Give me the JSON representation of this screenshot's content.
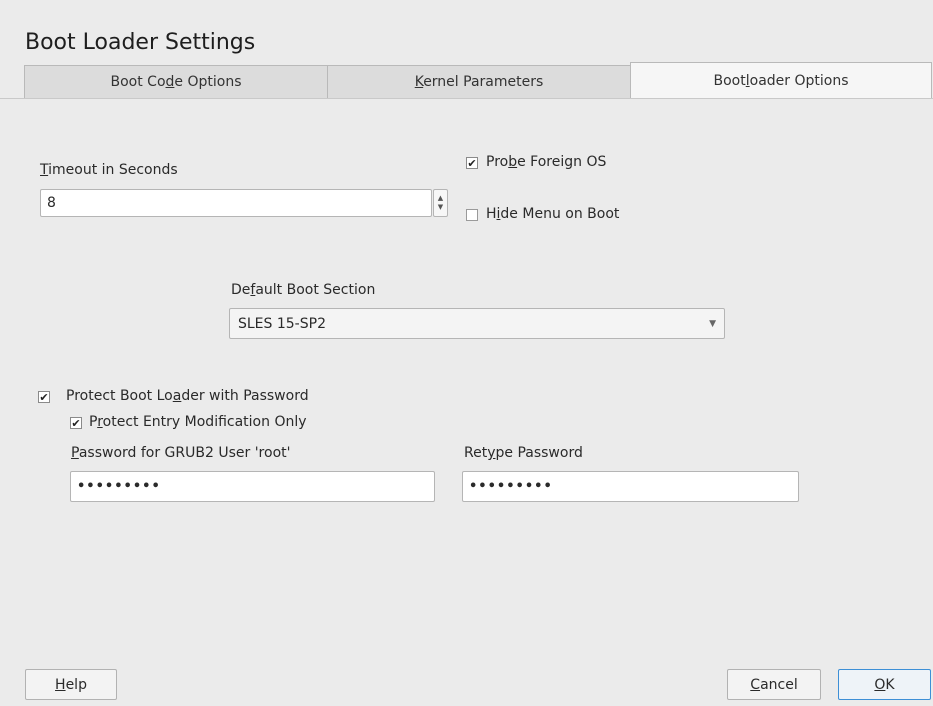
{
  "window": {
    "title": "Boot Loader Settings"
  },
  "tabs": [
    {
      "label_pre": "Boot Co",
      "label_u": "d",
      "label_post": "e Options",
      "active": false
    },
    {
      "label_pre": "",
      "label_u": "K",
      "label_post": "ernel Parameters",
      "active": false
    },
    {
      "label_pre": "Boot",
      "label_u": "l",
      "label_post": "oader Options",
      "active": true
    }
  ],
  "timeout": {
    "label_u": "T",
    "label_rest": "imeout in Seconds",
    "value": "8"
  },
  "probe_foreign_os": {
    "pre": "Pro",
    "u": "b",
    "post": "e Foreign OS",
    "checked": true
  },
  "hide_menu": {
    "pre": "H",
    "u": "i",
    "post": "de Menu on Boot",
    "checked": false
  },
  "default_boot": {
    "pre": "De",
    "u": "f",
    "post": "ault Boot Section",
    "value": "SLES 15-SP2"
  },
  "protect_password": {
    "pre": "Protect Boot Lo",
    "u": "a",
    "post": "der with Password",
    "checked": true
  },
  "protect_entry": {
    "pre": "P",
    "u": "r",
    "post": "otect Entry Modification Only",
    "checked": true
  },
  "password": {
    "u": "P",
    "rest": "assword for GRUB2 User 'root'",
    "value": "•••••••••"
  },
  "retype": {
    "pre": "Ret",
    "u": "y",
    "post": "pe Password",
    "value": "•••••••••"
  },
  "buttons": {
    "help": {
      "u": "H",
      "rest": "elp"
    },
    "cancel": {
      "u": "C",
      "rest": "ancel"
    },
    "ok": {
      "u": "O",
      "rest": "K"
    }
  },
  "icons": {
    "check": "✔",
    "spin_up": "▲",
    "spin_down": "▼",
    "dropdown": "▼"
  }
}
